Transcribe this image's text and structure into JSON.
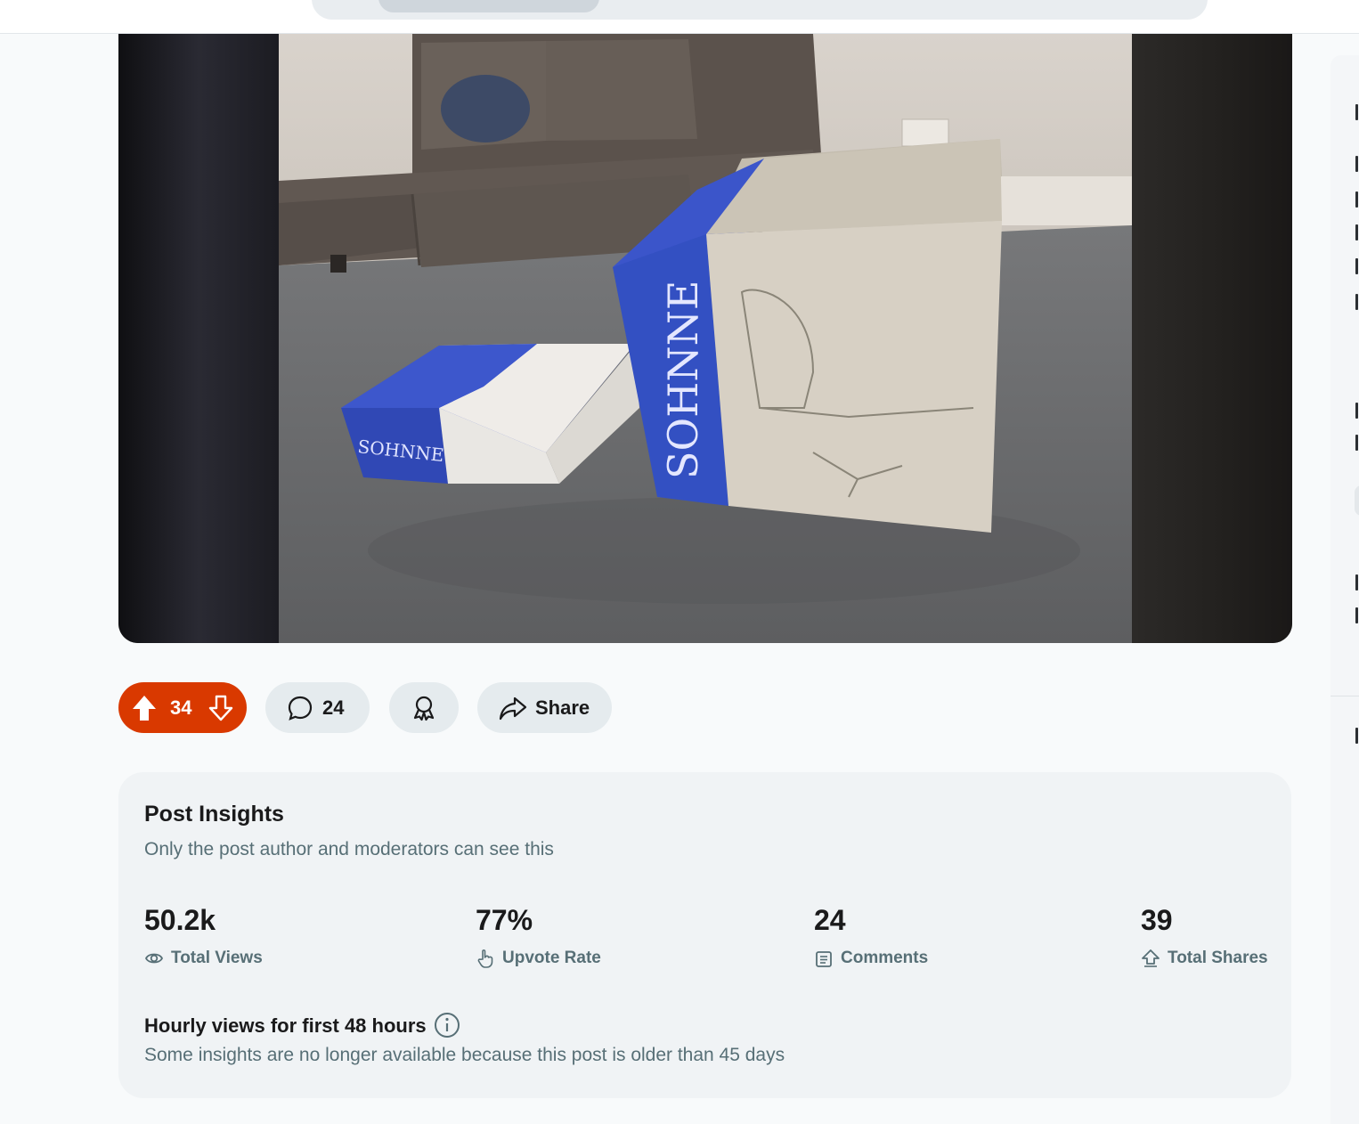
{
  "post": {
    "vote_count": "34",
    "comment_count": "24",
    "share_label": "Share",
    "box_brand_text": "SOHNNE"
  },
  "insights": {
    "title": "Post Insights",
    "subtitle": "Only the post author and moderators can see this",
    "stats": [
      {
        "value": "50.2k",
        "label": "Total Views",
        "icon": "eye-icon"
      },
      {
        "value": "77%",
        "label": "Upvote Rate",
        "icon": "hand-pointer-icon"
      },
      {
        "value": "24",
        "label": "Comments",
        "icon": "comments-icon"
      },
      {
        "value": "39",
        "label": "Total Shares",
        "icon": "share-up-icon"
      }
    ],
    "hourly_title": "Hourly views for first 48 hours",
    "hourly_subtitle": "Some insights are no longer available because this post is older than 45 days"
  },
  "colors": {
    "upvote_active": "#d93900",
    "pill_bg": "#e5ebee",
    "muted_text": "#576f76"
  }
}
